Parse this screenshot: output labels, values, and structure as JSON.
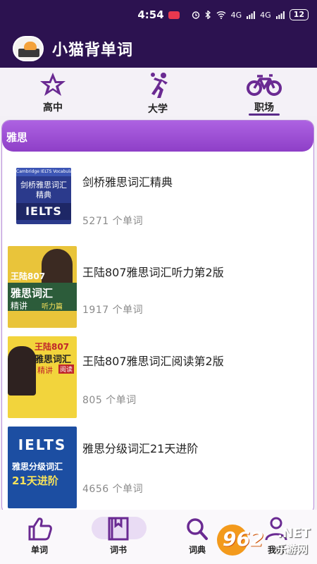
{
  "status_bar": {
    "time": "4:54",
    "network": "4G",
    "battery": "12"
  },
  "app": {
    "title": "小猫背单词"
  },
  "tabs": [
    {
      "label": "高中"
    },
    {
      "label": "大学"
    },
    {
      "label": "职场"
    }
  ],
  "section": {
    "title": "雅思"
  },
  "books": [
    {
      "title": "剑桥雅思词汇精典",
      "count": "5271 个单词",
      "cover_text": "剑桥雅思词汇精典",
      "cover_sub": "IELTS",
      "cover_top": "Cambridge IELTS Vocabulary Master"
    },
    {
      "title": "王陆807雅思词汇听力第2版",
      "count": "1917 个单词",
      "cover_text": "雅思词汇",
      "cover_sub": "精讲",
      "cover_top": "王陆807",
      "cover_tag": "听力篇"
    },
    {
      "title": "王陆807雅思词汇阅读第2版",
      "count": "805 个单词",
      "cover_text": "雅思词汇",
      "cover_sub": "精讲",
      "cover_top": "王陆807",
      "cover_tag": "阅读"
    },
    {
      "title": "雅思分级词汇21天进阶",
      "count": "4656 个单词",
      "cover_text": "雅思分级词汇",
      "cover_sub": "21天进阶",
      "cover_top": "IELTS"
    }
  ],
  "bottom_nav": [
    {
      "label": "单词"
    },
    {
      "label": "词书"
    },
    {
      "label": "词典"
    },
    {
      "label": "我的"
    }
  ],
  "watermark": {
    "brand": "962",
    "suffix": ".NET",
    "sub": "乐游网"
  },
  "colors": {
    "header": "#2c1250",
    "accent": "#5a2a8a",
    "section": "#9b4fd4"
  }
}
